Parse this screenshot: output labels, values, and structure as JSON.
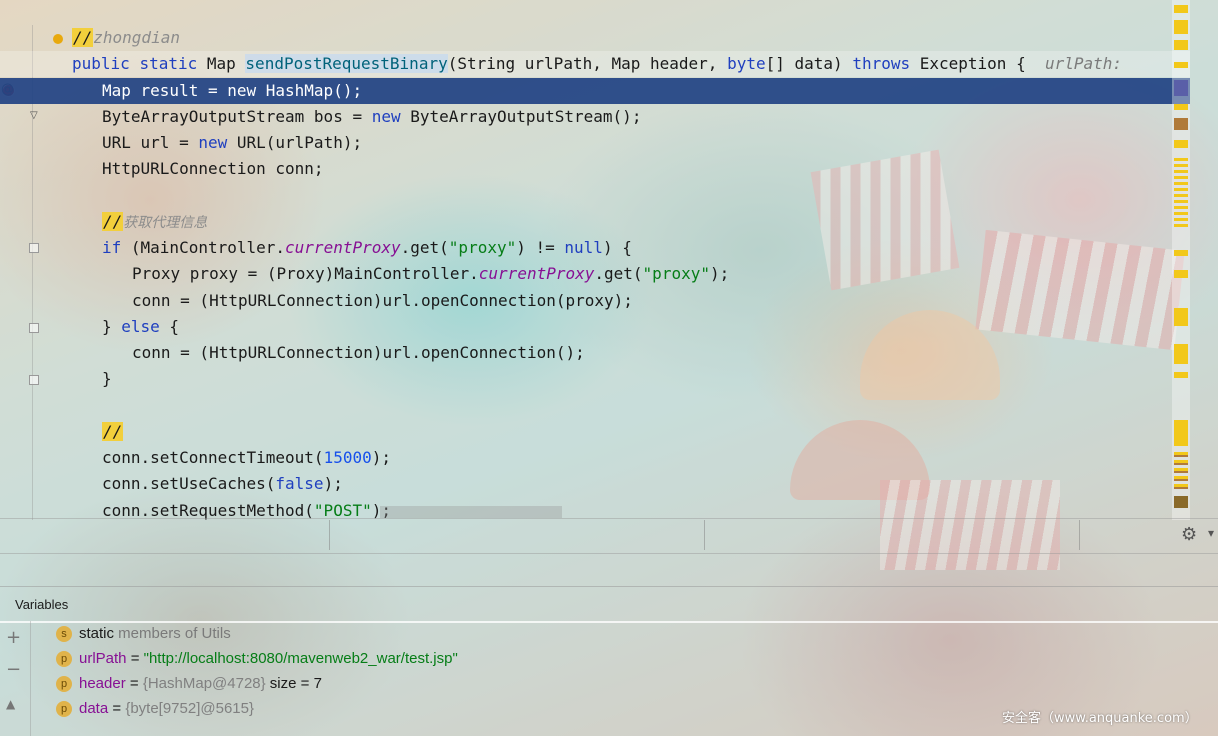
{
  "editor": {
    "line_todo_mark": "//",
    "line_todo_text": "zhongdian",
    "decl": {
      "kw1": "public",
      "kw2": "static",
      "type": "Map",
      "method": "sendPostRequestBinary",
      "params_a": "(String urlPath, Map header, ",
      "kw_byte": "byte",
      "params_b": "[] data) ",
      "kw_throws": "throws",
      "exc": " Exception {  ",
      "hint": "urlPath: "
    },
    "l_result": "Map result = new HashMap();",
    "l_bos_a": "ByteArrayOutputStream bos = ",
    "l_bos_kw": "new",
    "l_bos_b": " ByteArrayOutputStream();",
    "l_url_a": "URL url = ",
    "l_url_kw": "new",
    "l_url_b": " URL(urlPath);",
    "l_conn": "HttpURLConnection conn;",
    "c_proxy_mark": "//",
    "c_proxy_text": "获取代理信息",
    "if_kw": "if",
    "if_a": " (MainController.",
    "if_field": "currentProxy",
    "if_b": ".get(",
    "if_str": "\"proxy\"",
    "if_c": ") != ",
    "if_null": "null",
    "if_d": ") {",
    "p_a": "Proxy proxy = (Proxy)MainController.",
    "p_field": "currentProxy",
    "p_b": ".get(",
    "p_str": "\"proxy\"",
    "p_c": ");",
    "open_proxy": "conn = (HttpURLConnection)url.openConnection(proxy);",
    "else_a": "} ",
    "else_kw": "else",
    "else_b": " {",
    "open_plain": "conn = (HttpURLConnection)url.openConnection();",
    "close_brace": "}",
    "c_empty_mark": "//",
    "timeout_a": "conn.setConnectTimeout(",
    "timeout_num": "15000",
    "timeout_b": ");",
    "cache_a": "conn.setUseCaches(",
    "cache_kw": "false",
    "cache_b": ");",
    "method_a": "conn.setRequestMethod(",
    "method_str": "\"POST\"",
    "method_b": ");"
  },
  "variables": {
    "title": "Variables",
    "rows": [
      {
        "badge": "s",
        "name": "static",
        "rest": " members of Utils"
      },
      {
        "badge": "p",
        "name": "urlPath",
        "eq": " = ",
        "value": "\"http://localhost:8080/mavenweb2_war/test.jsp\""
      },
      {
        "badge": "p",
        "name": "header",
        "eq": " = ",
        "ref": "{HashMap@4728}",
        "extra": "  size = 7"
      },
      {
        "badge": "p",
        "name": "data",
        "eq": " = ",
        "ref": "{byte[9752]@5615}"
      }
    ]
  },
  "side_buttons": [
    "+",
    "−",
    "▲"
  ],
  "gutter_glyphs": {
    "at": "@",
    "arrow": "▽"
  },
  "gear_glyph": "⚙",
  "gear_arrow": "▾",
  "watermark": "安全客（www.anquanke.com）",
  "colors": {
    "current_line": "#214283",
    "todo": "#f2cf3c",
    "keyword": "#1f3fbf",
    "string": "#067d17"
  }
}
